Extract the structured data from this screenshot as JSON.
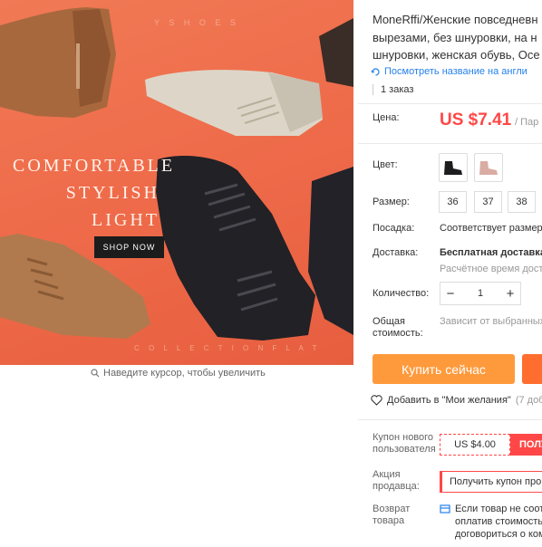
{
  "gallery": {
    "brand_text": "Y S H O E S",
    "slogan": [
      "COMFORTABLE",
      "STYLISH",
      "LIGHT"
    ],
    "shop_button": "SHOP NOW",
    "collection_text": "C O L L E C T I O N   F L A T",
    "zoom_hint": "Наведите курсор, чтобы увеличить",
    "zoom_icon": "magnifier-icon"
  },
  "product": {
    "title_lines": [
      "MoneRffi/Женские повседневн",
      "вырезами, без шнуровки, на н",
      "шнуровки, женская обувь, Осе"
    ],
    "translate_link": "Посмотреть название на англи",
    "orders": "1 заказ"
  },
  "price": {
    "label": "Цена:",
    "value": "US $7.41",
    "suffix": "/ Пар"
  },
  "color": {
    "label": "Цвет:",
    "options": [
      "black-boot",
      "pink-boot"
    ]
  },
  "size": {
    "label": "Размер:",
    "options": [
      "36",
      "37",
      "38"
    ]
  },
  "fit": {
    "label": "Посадка:",
    "value": "Соответствует размеру"
  },
  "delivery": {
    "label": "Доставка:",
    "value": "Бесплатная доставка",
    "note": "Расчётное время дост"
  },
  "quantity": {
    "label": "Количество:",
    "value": "1",
    "minus": "−",
    "plus": "+"
  },
  "total": {
    "label_lines": [
      "Общая",
      "стоимость:"
    ],
    "value": "Зависит от выбранных"
  },
  "actions": {
    "buy_now": "Купить сейчас",
    "wishlist": "Добавить в \"Мои желания\"",
    "wishlist_count": "(7 доб"
  },
  "coupons": {
    "new_user_label": [
      "Купон нового",
      "пользователя"
    ],
    "new_user_amount": "US $4.00",
    "new_user_get": "ПОЛУ",
    "seller_label": [
      "Акция",
      "продавца:"
    ],
    "seller_value": "Получить купон про"
  },
  "returns": {
    "label": [
      "Возврат",
      "товара"
    ],
    "text_lines": [
      "Если товар не соот",
      "оплатив стоимость",
      "договориться о ком"
    ]
  },
  "colors": {
    "accent_red": "#ff4747",
    "buy_orange": "#ff9a3c",
    "link_blue": "#2680eb",
    "hero_bg": "#ef6c4b"
  }
}
